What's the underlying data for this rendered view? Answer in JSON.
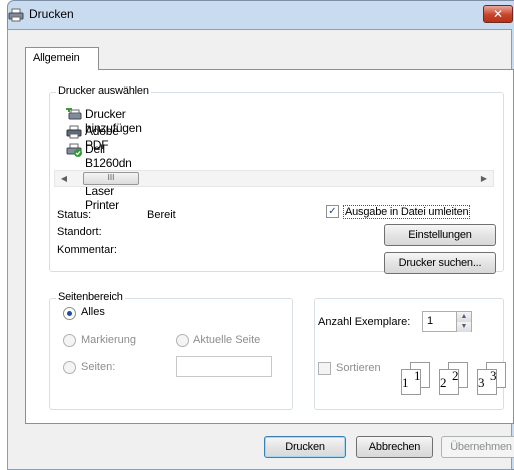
{
  "window": {
    "title": "Drucken",
    "close_glyph": "✕"
  },
  "tabs": [
    {
      "label": "Allgemein"
    }
  ],
  "printer_select": {
    "label": "Drucker auswählen",
    "printers": [
      {
        "name": "Drucker hinzufügen",
        "icon": "add-printer-icon"
      },
      {
        "name": "Adobe PDF",
        "icon": "printer-icon"
      },
      {
        "name": "Dell B1260dn Mono Laser Printer",
        "icon": "default-printer-icon"
      }
    ],
    "scroll": {
      "left": "◀",
      "right": "▶",
      "thumb": "III"
    },
    "status_label": "Status:",
    "status_value": "Bereit",
    "location_label": "Standort:",
    "comment_label": "Kommentar:",
    "print_to_file_label": "Ausgabe in Datei umleiten",
    "print_to_file_checked": true,
    "settings_button": "Einstellungen",
    "find_printer_button": "Drucker suchen..."
  },
  "page_range": {
    "label": "Seitenbereich",
    "all": "Alles",
    "selection": "Markierung",
    "current_page": "Aktuelle Seite",
    "pages": "Seiten:",
    "selected": "Alles"
  },
  "copies": {
    "label": "Anzahl Exemplare:",
    "value": "1",
    "collate_label": "Sortieren",
    "collate_checked": false
  },
  "buttons": {
    "print": "Drucken",
    "cancel": "Abbrechen",
    "apply": "Übernehmen"
  }
}
